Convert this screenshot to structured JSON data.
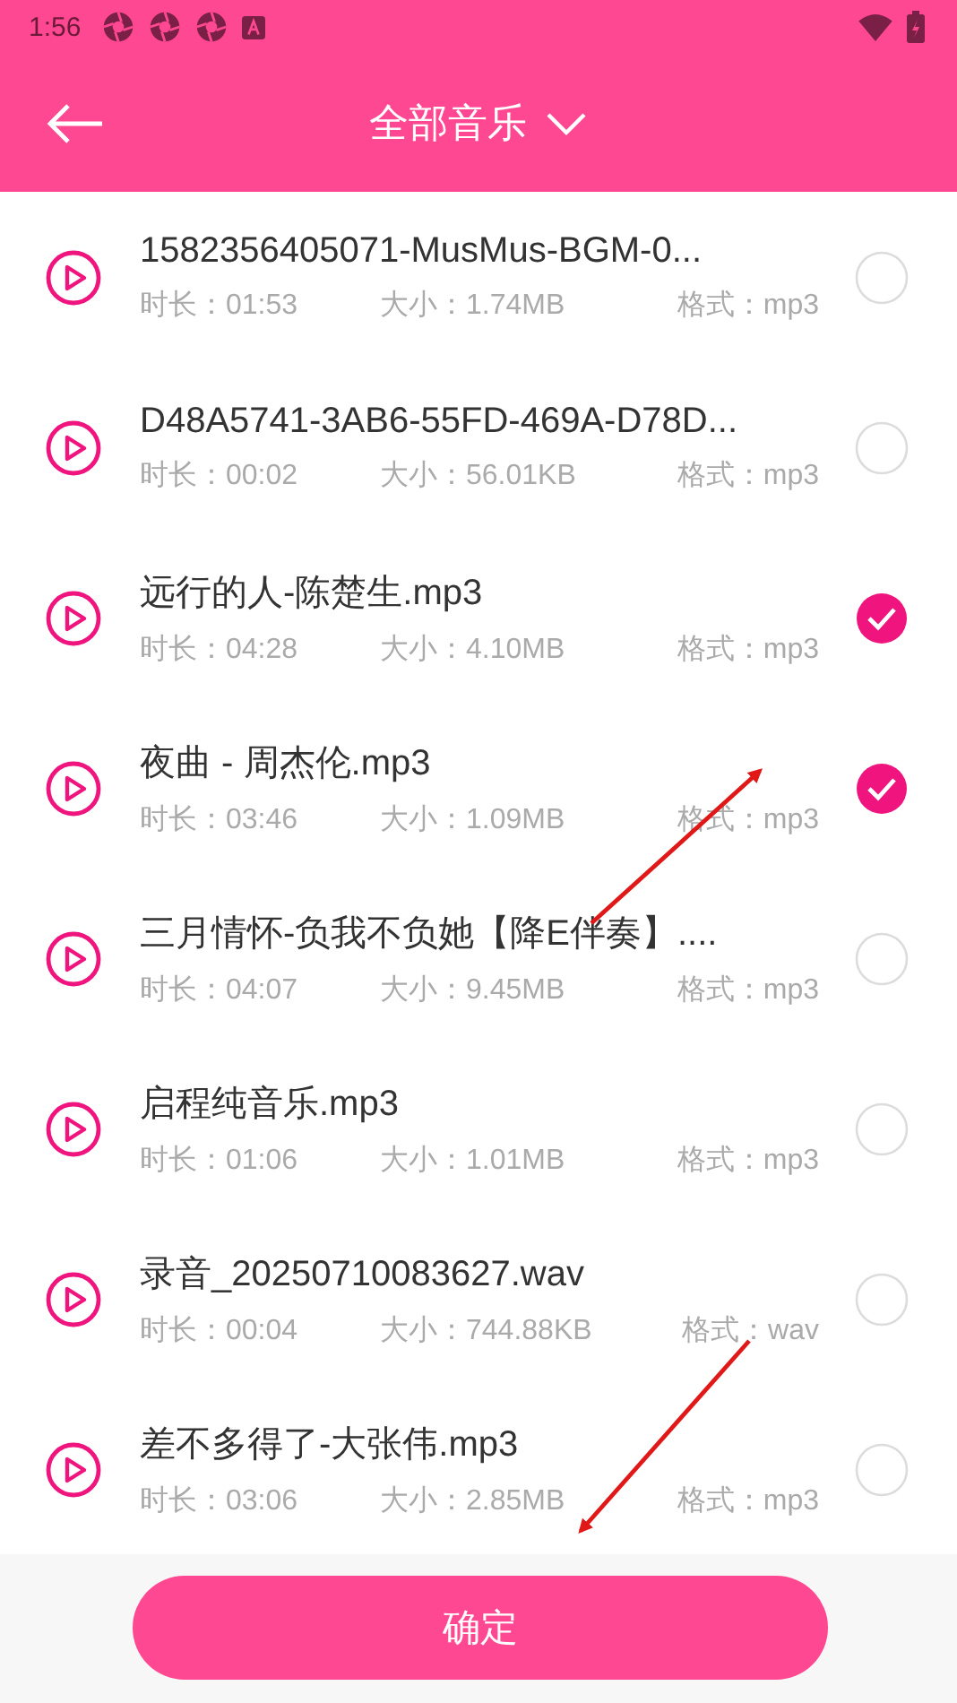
{
  "status_bar": {
    "time": "1:56"
  },
  "toolbar": {
    "title": "全部音乐"
  },
  "songs": [
    {
      "title": "1582356405071-MusMus-BGM-0...",
      "duration": "时长：01:53",
      "size": "大小：1.74MB",
      "format": "格式：mp3",
      "checked": false
    },
    {
      "title": "D48A5741-3AB6-55FD-469A-D78D...",
      "duration": "时长：00:02",
      "size": "大小：56.01KB",
      "format": "格式：mp3",
      "checked": false
    },
    {
      "title": "远行的人-陈楚生.mp3",
      "duration": "时长：04:28",
      "size": "大小：4.10MB",
      "format": "格式：mp3",
      "checked": true
    },
    {
      "title": "夜曲 - 周杰伦.mp3",
      "duration": "时长：03:46",
      "size": "大小：1.09MB",
      "format": "格式：mp3",
      "checked": true
    },
    {
      "title": "三月情怀-负我不负她【降E伴奏】....",
      "duration": "时长：04:07",
      "size": "大小：9.45MB",
      "format": "格式：mp3",
      "checked": false
    },
    {
      "title": "启程纯音乐.mp3",
      "duration": "时长：01:06",
      "size": "大小：1.01MB",
      "format": "格式：mp3",
      "checked": false
    },
    {
      "title": "录音_20250710083627.wav",
      "duration": "时长：00:04",
      "size": "大小：744.88KB",
      "format": "格式：wav",
      "checked": false
    },
    {
      "title": "差不多得了-大张伟.mp3",
      "duration": "时长：03:06",
      "size": "大小：2.85MB",
      "format": "格式：mp3",
      "checked": false
    }
  ],
  "confirm_button": "确定"
}
